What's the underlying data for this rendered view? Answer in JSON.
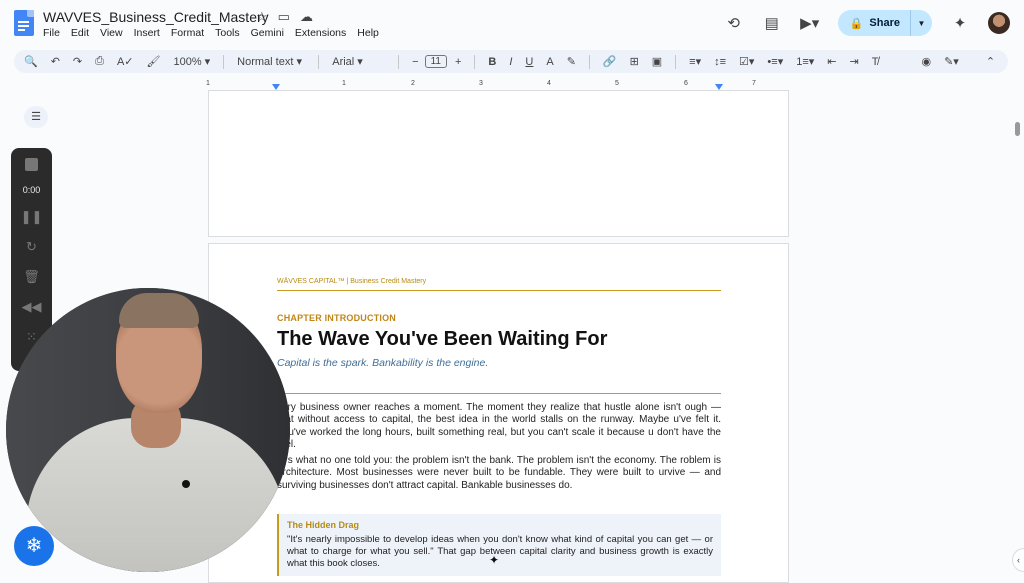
{
  "document": {
    "title": "WAVVES_Business_Credit_Mastery"
  },
  "menus": [
    "File",
    "Edit",
    "View",
    "Insert",
    "Format",
    "Tools",
    "Gemini",
    "Extensions",
    "Help"
  ],
  "header": {
    "share_label": "Share"
  },
  "toolbar": {
    "zoom": "100%",
    "style": "Normal text",
    "font": "Arial",
    "font_size": "11"
  },
  "ruler": {
    "numbers": [
      "1",
      "1",
      "2",
      "3",
      "4",
      "5",
      "6",
      "7"
    ]
  },
  "recorder": {
    "time": "0:00"
  },
  "page": {
    "header": "WÄVVES CAPITAL™  |  Business Credit Mastery",
    "section_label": "CHAPTER INTRODUCTION",
    "heading": "The Wave You've Been Waiting For",
    "subtitle": "Capital is the spark. Bankability is the engine.",
    "paragraph1": "very business owner reaches a moment. The moment they realize that hustle alone isn't ough — that without access to capital, the best idea in the world stalls on the runway. Maybe u've felt it. You've worked the long hours, built something real, but you can't scale it because u don't have the fuel.",
    "paragraph2": "re's what no one told you: the problem isn't the bank. The problem isn't the economy. The roblem is architecture. Most businesses were never built to be fundable. They were built to urvive — and surviving businesses don't attract capital. Bankable businesses do.",
    "callout_title": "The Hidden Drag",
    "callout_body": "\"It's nearly impossible to develop ideas when you don't know what kind of capital you can get — or what to charge for what you sell.\" That gap between capital clarity and business growth is exactly what this book closes."
  },
  "colors": {
    "accent_gold": "#c99b1d",
    "link_blue": "#3f6f99",
    "share_bg": "#c2e7ff",
    "doc_blue": "#4285f4"
  }
}
